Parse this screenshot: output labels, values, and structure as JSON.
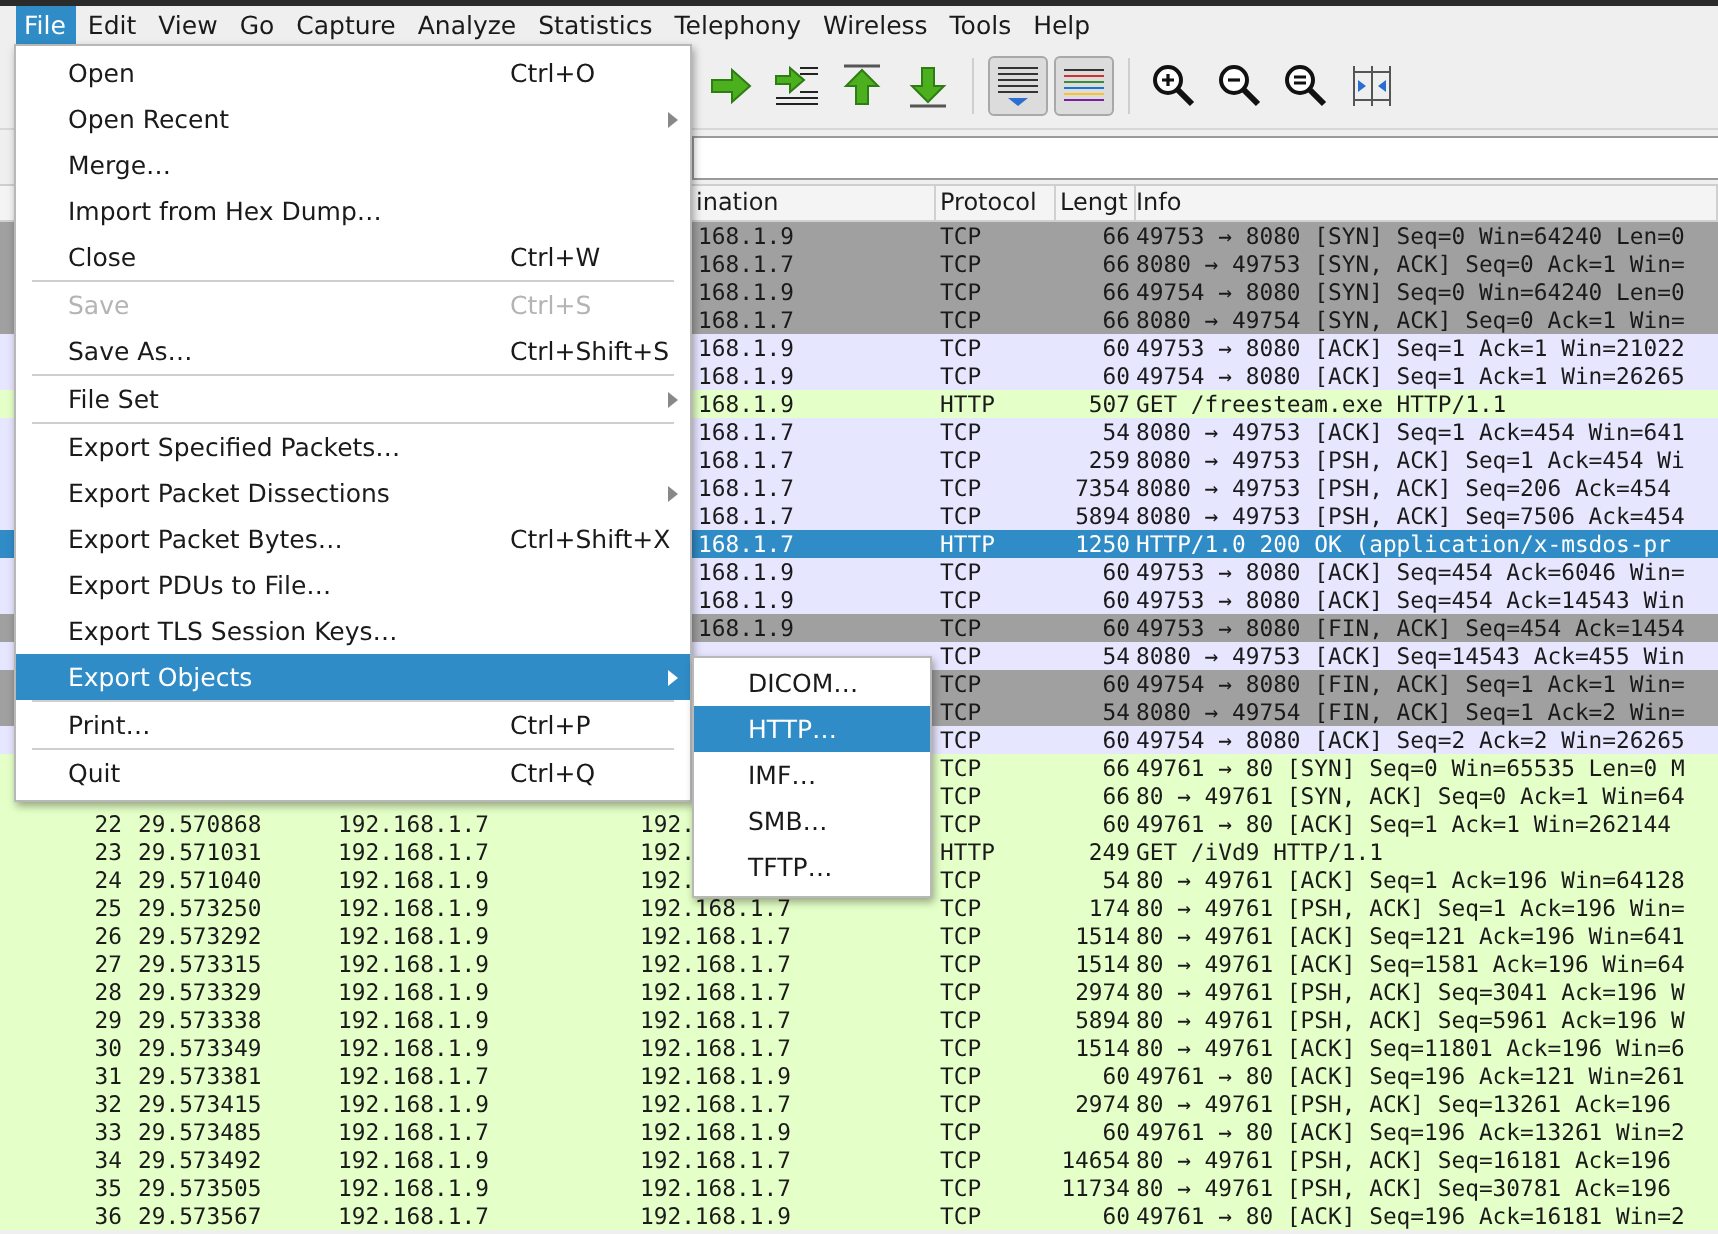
{
  "menubar": [
    {
      "label": "File",
      "selected": true
    },
    {
      "label": "Edit",
      "selected": false
    },
    {
      "label": "View",
      "selected": false
    },
    {
      "label": "Go",
      "selected": false
    },
    {
      "label": "Capture",
      "selected": false
    },
    {
      "label": "Analyze",
      "selected": false
    },
    {
      "label": "Statistics",
      "selected": false
    },
    {
      "label": "Telephony",
      "selected": false
    },
    {
      "label": "Wireless",
      "selected": false
    },
    {
      "label": "Tools",
      "selected": false
    },
    {
      "label": "Help",
      "selected": false
    }
  ],
  "toolbar": [
    {
      "kind": "forward",
      "pressed": false
    },
    {
      "kind": "jump",
      "pressed": false
    },
    {
      "kind": "first",
      "pressed": false
    },
    {
      "kind": "last",
      "pressed": false
    },
    {
      "kind": "autoscroll",
      "pressed": true
    },
    {
      "kind": "colorize",
      "pressed": true
    },
    {
      "kind": "zoom-in",
      "pressed": false
    },
    {
      "kind": "zoom-out",
      "pressed": false
    },
    {
      "kind": "zoom-reset",
      "pressed": false
    },
    {
      "kind": "resize-columns",
      "pressed": false
    }
  ],
  "packets": {
    "columns": [
      {
        "label": "ination"
      },
      {
        "label": "Protocol"
      },
      {
        "label": "Lengt"
      },
      {
        "label": "Info"
      }
    ],
    "rows": [
      {
        "destination": "168.1.9",
        "protocol": "TCP",
        "length": "66",
        "info": "49753 → 8080 [SYN] Seq=0 Win=64240 Len=0",
        "color": "#a0a0a0",
        "selected": false
      },
      {
        "destination": "168.1.7",
        "protocol": "TCP",
        "length": "66",
        "info": "8080 → 49753 [SYN, ACK] Seq=0 Ack=1 Win=",
        "color": "#a0a0a0",
        "selected": false
      },
      {
        "destination": "168.1.9",
        "protocol": "TCP",
        "length": "66",
        "info": "49754 → 8080 [SYN] Seq=0 Win=64240 Len=0",
        "color": "#a0a0a0",
        "selected": false
      },
      {
        "destination": "168.1.7",
        "protocol": "TCP",
        "length": "66",
        "info": "8080 → 49754 [SYN, ACK] Seq=0 Ack=1 Win=",
        "color": "#a0a0a0",
        "selected": false
      },
      {
        "destination": "168.1.9",
        "protocol": "TCP",
        "length": "60",
        "info": "49753 → 8080 [ACK] Seq=1 Ack=1 Win=21022",
        "color": "#e7e6ff",
        "selected": false
      },
      {
        "destination": "168.1.9",
        "protocol": "TCP",
        "length": "60",
        "info": "49754 → 8080 [ACK] Seq=1 Ack=1 Win=26265",
        "color": "#e7e6ff",
        "selected": false
      },
      {
        "destination": "168.1.9",
        "protocol": "HTTP",
        "length": "507",
        "info": "GET /freesteam.exe HTTP/1.1",
        "color": "#e4ffc7",
        "selected": false
      },
      {
        "destination": "168.1.7",
        "protocol": "TCP",
        "length": "54",
        "info": "8080 → 49753 [ACK] Seq=1 Ack=454 Win=641",
        "color": "#e7e6ff",
        "selected": false
      },
      {
        "destination": "168.1.7",
        "protocol": "TCP",
        "length": "259",
        "info": "8080 → 49753 [PSH, ACK] Seq=1 Ack=454 Wi",
        "color": "#e7e6ff",
        "selected": false
      },
      {
        "destination": "168.1.7",
        "protocol": "TCP",
        "length": "7354",
        "info": "8080 → 49753 [PSH, ACK] Seq=206 Ack=454",
        "color": "#e7e6ff",
        "selected": false
      },
      {
        "destination": "168.1.7",
        "protocol": "TCP",
        "length": "5894",
        "info": "8080 → 49753 [PSH, ACK] Seq=7506 Ack=454",
        "color": "#e7e6ff",
        "selected": false
      },
      {
        "destination": "168.1.7",
        "protocol": "HTTP",
        "length": "1250",
        "info": "HTTP/1.0 200 OK  (application/x-msdos-pr",
        "selected": true
      },
      {
        "destination": "168.1.9",
        "protocol": "TCP",
        "length": "60",
        "info": "49753 → 8080 [ACK] Seq=454 Ack=6046 Win=",
        "color": "#e7e6ff",
        "selected": false
      },
      {
        "destination": "168.1.9",
        "protocol": "TCP",
        "length": "60",
        "info": "49753 → 8080 [ACK] Seq=454 Ack=14543 Win",
        "color": "#e7e6ff",
        "selected": false
      },
      {
        "destination": "168.1.9",
        "protocol": "TCP",
        "length": "60",
        "info": "49753 → 8080 [FIN, ACK] Seq=454 Ack=1454",
        "color": "#a0a0a0",
        "selected": false
      },
      {
        "protocol": "TCP",
        "length": "54",
        "info": "8080 → 49753 [ACK] Seq=14543 Ack=455 Win",
        "color": "#e7e6ff",
        "selected": false
      },
      {
        "protocol": "TCP",
        "length": "60",
        "info": "49754 → 8080 [FIN, ACK] Seq=1 Ack=1 Win=",
        "color": "#a0a0a0",
        "selected": false
      },
      {
        "protocol": "TCP",
        "length": "54",
        "info": "8080 → 49754 [FIN, ACK] Seq=1 Ack=2 Win=",
        "color": "#a0a0a0",
        "selected": false
      },
      {
        "protocol": "TCP",
        "length": "60",
        "info": "49754 → 8080 [ACK] Seq=2 Ack=2 Win=26265",
        "color": "#e7e6ff",
        "selected": false
      },
      {
        "protocol": "TCP",
        "length": "66",
        "info": "49761 → 80 [SYN] Seq=0 Win=65535 Len=0 M",
        "color": "#e4ffc7",
        "selected": false
      },
      {
        "protocol": "TCP",
        "length": "66",
        "info": "80 → 49761 [SYN, ACK] Seq=0 Ack=1 Win=64",
        "color": "#e4ffc7",
        "selected": false
      },
      {
        "no": "22",
        "time": "29.570868",
        "source": "192.168.1.7",
        "destination": "192.",
        "protocol": "TCP",
        "length": "60",
        "info": "49761 → 80 [ACK] Seq=1 Ack=1 Win=262144",
        "color": "#e4ffc7",
        "selected": false
      },
      {
        "no": "23",
        "time": "29.571031",
        "source": "192.168.1.7",
        "destination": "192.",
        "protocol": "HTTP",
        "length": "249",
        "info": "GET /iVd9 HTTP/1.1",
        "color": "#e4ffc7",
        "selected": false
      },
      {
        "no": "24",
        "time": "29.571040",
        "source": "192.168.1.9",
        "destination": "192.",
        "protocol": "TCP",
        "length": "54",
        "info": "80 → 49761 [ACK] Seq=1 Ack=196 Win=64128",
        "color": "#e4ffc7",
        "selected": false
      },
      {
        "no": "25",
        "time": "29.573250",
        "source": "192.168.1.9",
        "destination": "192.168.1.7",
        "protocol": "TCP",
        "length": "174",
        "info": "80 → 49761 [PSH, ACK] Seq=1 Ack=196 Win=",
        "color": "#e4ffc7",
        "selected": false
      },
      {
        "no": "26",
        "time": "29.573292",
        "source": "192.168.1.9",
        "destination": "192.168.1.7",
        "protocol": "TCP",
        "length": "1514",
        "info": "80 → 49761 [ACK] Seq=121 Ack=196 Win=641",
        "color": "#e4ffc7",
        "selected": false
      },
      {
        "no": "27",
        "time": "29.573315",
        "source": "192.168.1.9",
        "destination": "192.168.1.7",
        "protocol": "TCP",
        "length": "1514",
        "info": "80 → 49761 [ACK] Seq=1581 Ack=196 Win=64",
        "color": "#e4ffc7",
        "selected": false
      },
      {
        "no": "28",
        "time": "29.573329",
        "source": "192.168.1.9",
        "destination": "192.168.1.7",
        "protocol": "TCP",
        "length": "2974",
        "info": "80 → 49761 [PSH, ACK] Seq=3041 Ack=196 W",
        "color": "#e4ffc7",
        "selected": false
      },
      {
        "no": "29",
        "time": "29.573338",
        "source": "192.168.1.9",
        "destination": "192.168.1.7",
        "protocol": "TCP",
        "length": "5894",
        "info": "80 → 49761 [PSH, ACK] Seq=5961 Ack=196 W",
        "color": "#e4ffc7",
        "selected": false
      },
      {
        "no": "30",
        "time": "29.573349",
        "source": "192.168.1.9",
        "destination": "192.168.1.7",
        "protocol": "TCP",
        "length": "1514",
        "info": "80 → 49761 [ACK] Seq=11801 Ack=196 Win=6",
        "color": "#e4ffc7",
        "selected": false
      },
      {
        "no": "31",
        "time": "29.573381",
        "source": "192.168.1.7",
        "destination": "192.168.1.9",
        "protocol": "TCP",
        "length": "60",
        "info": "49761 → 80 [ACK] Seq=196 Ack=121 Win=261",
        "color": "#e4ffc7",
        "selected": false
      },
      {
        "no": "32",
        "time": "29.573415",
        "source": "192.168.1.9",
        "destination": "192.168.1.7",
        "protocol": "TCP",
        "length": "2974",
        "info": "80 → 49761 [PSH, ACK] Seq=13261 Ack=196",
        "color": "#e4ffc7",
        "selected": false
      },
      {
        "no": "33",
        "time": "29.573485",
        "source": "192.168.1.7",
        "destination": "192.168.1.9",
        "protocol": "TCP",
        "length": "60",
        "info": "49761 → 80 [ACK] Seq=196 Ack=13261 Win=2",
        "color": "#e4ffc7",
        "selected": false
      },
      {
        "no": "34",
        "time": "29.573492",
        "source": "192.168.1.9",
        "destination": "192.168.1.7",
        "protocol": "TCP",
        "length": "14654",
        "info": "80 → 49761 [PSH, ACK] Seq=16181 Ack=196",
        "color": "#e4ffc7",
        "selected": false
      },
      {
        "no": "35",
        "time": "29.573505",
        "source": "192.168.1.9",
        "destination": "192.168.1.7",
        "protocol": "TCP",
        "length": "11734",
        "info": "80 → 49761 [PSH, ACK] Seq=30781 Ack=196",
        "color": "#e4ffc7",
        "selected": false
      },
      {
        "no": "36",
        "time": "29.573567",
        "source": "192.168.1.7",
        "destination": "192.168.1.9",
        "protocol": "TCP",
        "length": "60",
        "info": "49761 → 80 [ACK] Seq=196 Ack=16181 Win=2",
        "color": "#e4ffc7",
        "selected": false
      }
    ]
  },
  "file_menu": {
    "items": [
      {
        "kind": "item",
        "label": "Open",
        "shortcut": "Ctrl+O",
        "submenu": false,
        "disabled": false,
        "selected": false
      },
      {
        "kind": "item",
        "label": "Open Recent",
        "submenu": true,
        "disabled": false,
        "selected": false
      },
      {
        "kind": "item",
        "label": "Merge…",
        "submenu": false,
        "disabled": false,
        "selected": false
      },
      {
        "kind": "item",
        "label": "Import from Hex Dump…",
        "submenu": false,
        "disabled": false,
        "selected": false
      },
      {
        "kind": "item",
        "label": "Close",
        "shortcut": "Ctrl+W",
        "submenu": false,
        "disabled": false,
        "selected": false
      },
      {
        "kind": "separator"
      },
      {
        "kind": "item",
        "label": "Save",
        "shortcut": "Ctrl+S",
        "submenu": false,
        "disabled": true,
        "selected": false
      },
      {
        "kind": "item",
        "label": "Save As…",
        "shortcut": "Ctrl+Shift+S",
        "submenu": false,
        "disabled": false,
        "selected": false
      },
      {
        "kind": "separator"
      },
      {
        "kind": "item",
        "label": "File Set",
        "submenu": true,
        "disabled": false,
        "selected": false
      },
      {
        "kind": "separator"
      },
      {
        "kind": "item",
        "label": "Export Specified Packets…",
        "submenu": false,
        "disabled": false,
        "selected": false
      },
      {
        "kind": "item",
        "label": "Export Packet Dissections",
        "submenu": true,
        "disabled": false,
        "selected": false
      },
      {
        "kind": "item",
        "label": "Export Packet Bytes…",
        "shortcut": "Ctrl+Shift+X",
        "submenu": false,
        "disabled": false,
        "selected": false
      },
      {
        "kind": "item",
        "label": "Export PDUs to File…",
        "submenu": false,
        "disabled": false,
        "selected": false
      },
      {
        "kind": "item",
        "label": "Export TLS Session Keys…",
        "submenu": false,
        "disabled": false,
        "selected": false
      },
      {
        "kind": "item",
        "label": "Export Objects",
        "submenu": true,
        "disabled": false,
        "selected": true
      },
      {
        "kind": "separator"
      },
      {
        "kind": "item",
        "label": "Print…",
        "shortcut": "Ctrl+P",
        "submenu": false,
        "disabled": false,
        "selected": false
      },
      {
        "kind": "separator"
      },
      {
        "kind": "item",
        "label": "Quit",
        "shortcut": "Ctrl+Q",
        "submenu": false,
        "disabled": false,
        "selected": false
      }
    ]
  },
  "export_objects_menu": {
    "items": [
      {
        "label": "DICOM…",
        "selected": false
      },
      {
        "label": "HTTP…",
        "selected": true
      },
      {
        "label": "IMF…",
        "selected": false
      },
      {
        "label": "SMB…",
        "selected": false
      },
      {
        "label": "TFTP…",
        "selected": false
      }
    ]
  }
}
